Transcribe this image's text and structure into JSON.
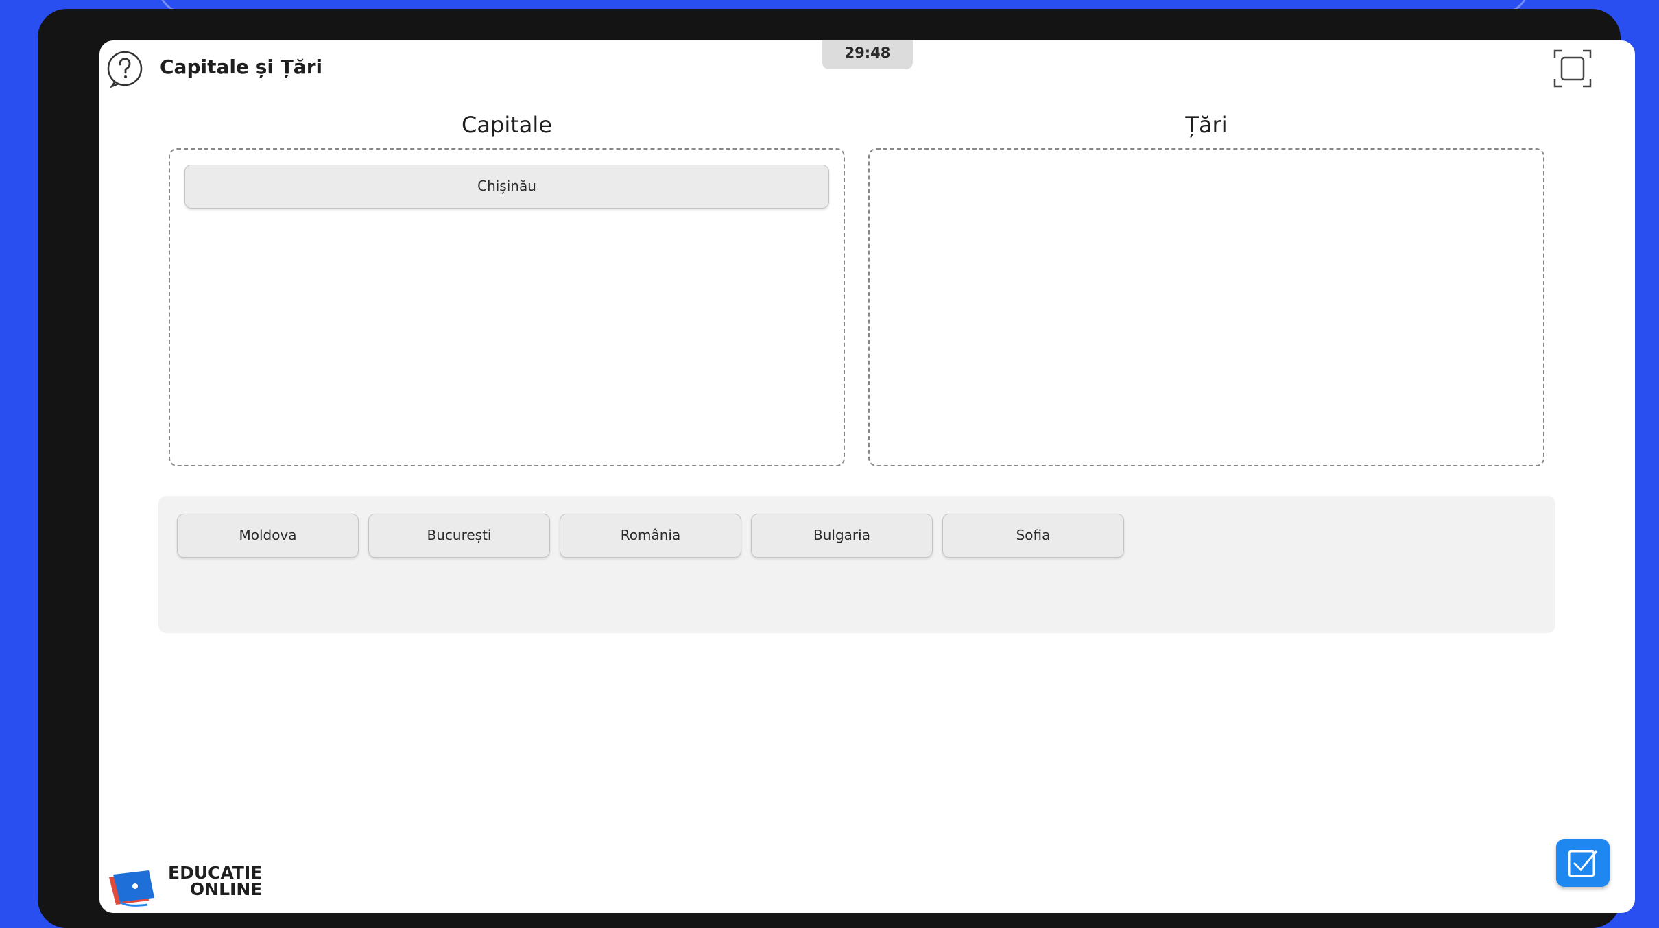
{
  "header": {
    "title": "Capitale și Țări",
    "timer": "29:48"
  },
  "columns": {
    "left_title": "Capitale",
    "right_title": "Țări"
  },
  "dropzones": {
    "left_items": [
      "Chișinău"
    ],
    "right_items": []
  },
  "pool": {
    "cards": [
      "Moldova",
      "București",
      "România",
      "Bulgaria",
      "Sofia"
    ]
  },
  "logo": {
    "line1": "EDUCATIE",
    "line2": "ONLINE"
  },
  "icons": {
    "help": "question-circle-icon",
    "fullscreen": "fullscreen-icon",
    "check": "checkmark-square-icon"
  },
  "colors": {
    "background": "#2a4ff0",
    "accent": "#1e88f0"
  }
}
